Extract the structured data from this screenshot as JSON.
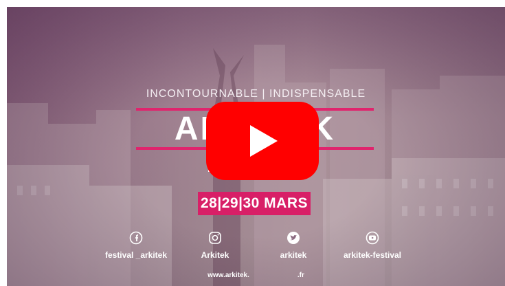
{
  "video": {
    "tagline": "INCONTOURNABLE | INDISPENSABLE",
    "title": "ARKITEK",
    "subtitle": "BORDEAUX",
    "dates": "28|29|30 MARS",
    "website": "www.arkitek.",
    "website_suffix": ".fr"
  },
  "socials": [
    {
      "icon": "facebook-icon",
      "label": "festival _arkitek"
    },
    {
      "icon": "instagram-icon",
      "label": "Arkitek"
    },
    {
      "icon": "twitter-icon",
      "label": "arkitek"
    },
    {
      "icon": "youtube-icon",
      "label": "arkitek-festival"
    }
  ],
  "colors": {
    "accent": "#e0246d",
    "play_button": "#ff0000"
  }
}
